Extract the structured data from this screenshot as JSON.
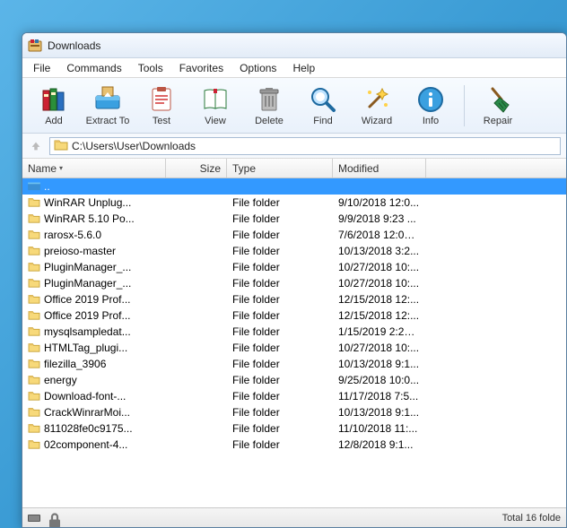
{
  "window": {
    "title": "Downloads"
  },
  "menu": {
    "file": "File",
    "commands": "Commands",
    "tools": "Tools",
    "favorites": "Favorites",
    "options": "Options",
    "help": "Help"
  },
  "toolbar": {
    "add": "Add",
    "extract": "Extract To",
    "test": "Test",
    "view": "View",
    "delete": "Delete",
    "find": "Find",
    "wizard": "Wizard",
    "info": "Info",
    "repair": "Repair"
  },
  "address": {
    "path": "C:\\Users\\User\\Downloads"
  },
  "columns": {
    "name": "Name",
    "size": "Size",
    "type": "Type",
    "modified": "Modified"
  },
  "rows": [
    {
      "name": "..",
      "size": "",
      "type": "",
      "modified": "",
      "icon": "up"
    },
    {
      "name": "WinRAR Unplug...",
      "size": "",
      "type": "File folder",
      "modified": "9/10/2018 12:0...",
      "icon": "folder"
    },
    {
      "name": "WinRAR 5.10 Po...",
      "size": "",
      "type": "File folder",
      "modified": "9/9/2018 9:23 ...",
      "icon": "folder"
    },
    {
      "name": "rarosx-5.6.0",
      "size": "",
      "type": "File folder",
      "modified": "7/6/2018 12:02 ...",
      "icon": "folder"
    },
    {
      "name": "preioso-master",
      "size": "",
      "type": "File folder",
      "modified": "10/13/2018 3:2...",
      "icon": "folder"
    },
    {
      "name": "PluginManager_...",
      "size": "",
      "type": "File folder",
      "modified": "10/27/2018 10:...",
      "icon": "folder"
    },
    {
      "name": "PluginManager_...",
      "size": "",
      "type": "File folder",
      "modified": "10/27/2018 10:...",
      "icon": "folder"
    },
    {
      "name": "Office 2019 Prof...",
      "size": "",
      "type": "File folder",
      "modified": "12/15/2018 12:...",
      "icon": "folder"
    },
    {
      "name": "Office 2019 Prof...",
      "size": "",
      "type": "File folder",
      "modified": "12/15/2018 12:...",
      "icon": "folder"
    },
    {
      "name": "mysqlsampledat...",
      "size": "",
      "type": "File folder",
      "modified": "1/15/2019 2:21 ...",
      "icon": "folder"
    },
    {
      "name": "HTMLTag_plugi...",
      "size": "",
      "type": "File folder",
      "modified": "10/27/2018 10:...",
      "icon": "folder"
    },
    {
      "name": "filezilla_3906",
      "size": "",
      "type": "File folder",
      "modified": "10/13/2018 9:1...",
      "icon": "folder"
    },
    {
      "name": "energy",
      "size": "",
      "type": "File folder",
      "modified": "9/25/2018 10:0...",
      "icon": "folder"
    },
    {
      "name": "Download-font-...",
      "size": "",
      "type": "File folder",
      "modified": "11/17/2018 7:5...",
      "icon": "folder"
    },
    {
      "name": "CrackWinrarMoi...",
      "size": "",
      "type": "File folder",
      "modified": "10/13/2018 9:1...",
      "icon": "folder"
    },
    {
      "name": "811028fe0c9175...",
      "size": "",
      "type": "File folder",
      "modified": "11/10/2018 11:...",
      "icon": "folder"
    },
    {
      "name": "02component-4...",
      "size": "",
      "type": "File folder",
      "modified": "12/8/2018 9:1...",
      "icon": "folder"
    }
  ],
  "status": {
    "right": "Total 16 folde"
  }
}
